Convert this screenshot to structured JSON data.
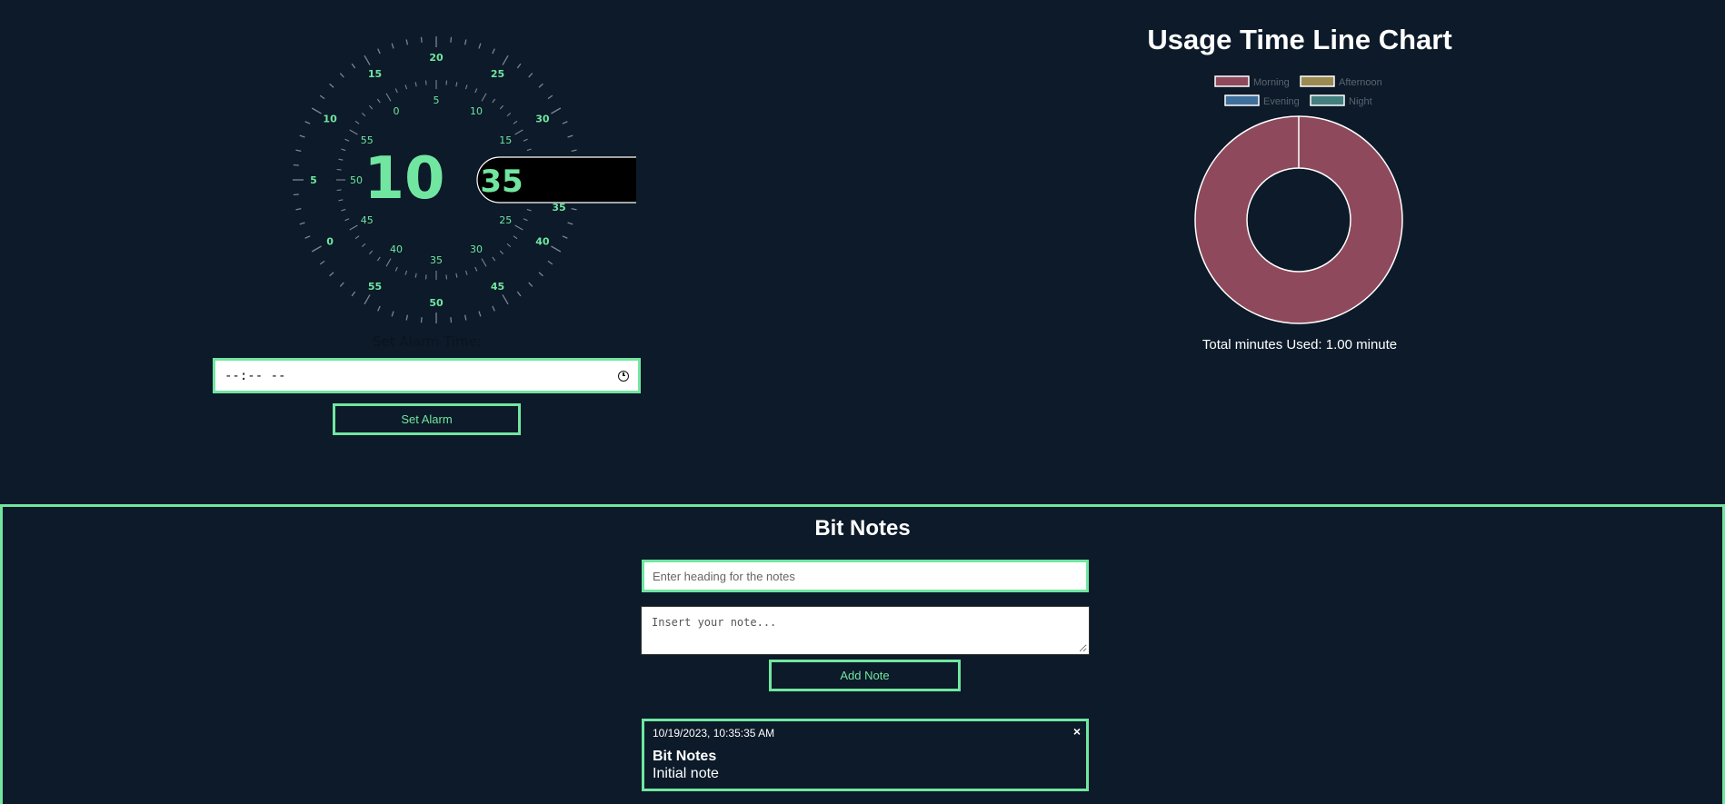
{
  "clock": {
    "hour": "10",
    "minute": "35",
    "outer_labels": [
      "35",
      "40",
      "45",
      "50",
      "55",
      "0",
      "5",
      "10",
      "15",
      "20",
      "25",
      "30"
    ],
    "inner_labels": [
      "20",
      "25",
      "30",
      "35",
      "40",
      "45",
      "50",
      "55",
      "0",
      "5",
      "10",
      "15"
    ],
    "colors": {
      "accent": "#71e6a0",
      "tick": "#7b8593",
      "highlight_bg": "#000000"
    }
  },
  "alarm": {
    "label": "Set Alarm Time:",
    "time_value": "--:-- --",
    "button_label": "Set Alarm"
  },
  "chart": {
    "title": "Usage Time Line Chart",
    "total_label": "Total minutes Used: 1.00 minute"
  },
  "chart_data": {
    "type": "pie",
    "variant": "doughnut",
    "title": "Usage Time Line Chart",
    "categories": [
      "Morning",
      "Afternoon",
      "Evening",
      "Night"
    ],
    "values": [
      1,
      0,
      0,
      0
    ],
    "colors": [
      "#8e4a5c",
      "#9b8a52",
      "#3f6f9b",
      "#447f7f"
    ],
    "legend_position": "top"
  },
  "notes": {
    "title": "Bit Notes",
    "heading_placeholder": "Enter heading for the notes",
    "body_placeholder": "Insert your note...",
    "add_button": "Add Note",
    "close_symbol": "×",
    "items": [
      {
        "date": "10/19/2023, 10:35:35 AM",
        "title": "Bit Notes",
        "text": "Initial note"
      }
    ]
  }
}
